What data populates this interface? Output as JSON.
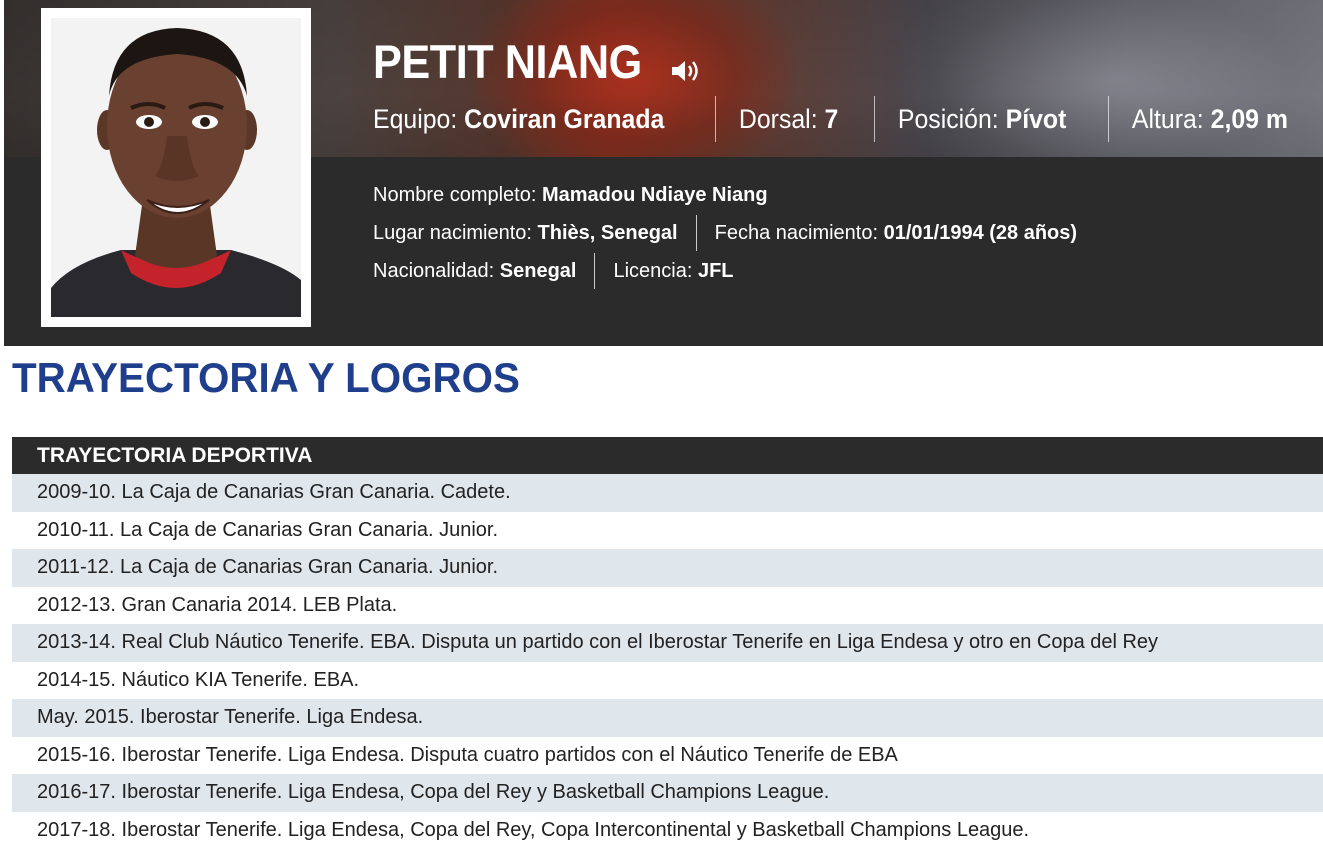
{
  "player": {
    "name": "PETIT NIANG",
    "team_label": "Equipo:",
    "team": "Coviran Granada",
    "number_label": "Dorsal:",
    "number": "7",
    "position_label": "Posición:",
    "position": "Pívot",
    "height_label": "Altura:",
    "height": "2,09 m",
    "full_name_label": "Nombre completo:",
    "full_name": "Mamadou Ndiaye Niang",
    "birthplace_label": "Lugar nacimiento:",
    "birthplace": "Thiès, Senegal",
    "birthdate_label": "Fecha nacimiento:",
    "birthdate": "01/01/1994 (28 años)",
    "nationality_label": "Nacionalidad:",
    "nationality": "Senegal",
    "license_label": "Licencia:",
    "license": "JFL"
  },
  "section": {
    "title": "TRAYECTORIA Y LOGROS"
  },
  "career": {
    "header": "TRAYECTORIA DEPORTIVA",
    "items": [
      "2009-10. La Caja de Canarias Gran Canaria. Cadete.",
      "2010-11. La Caja de Canarias Gran Canaria. Junior.",
      "2011-12. La Caja de Canarias Gran Canaria. Junior.",
      "2012-13. Gran Canaria 2014. LEB Plata.",
      "2013-14. Real Club Náutico Tenerife. EBA. Disputa un partido con el Iberostar Tenerife en Liga Endesa y otro en Copa del Rey",
      "2014-15. Náutico KIA Tenerife. EBA.",
      "May. 2015. Iberostar Tenerife. Liga Endesa.",
      "2015-16. Iberostar Tenerife. Liga Endesa. Disputa cuatro partidos con el Náutico Tenerife de EBA",
      "2016-17. Iberostar Tenerife. Liga Endesa, Copa del Rey y Basketball Champions League.",
      "2017-18. Iberostar Tenerife. Liga Endesa, Copa del Rey, Copa Intercontinental y Basketball Champions League."
    ]
  },
  "icons": {
    "audio": "speaker-icon"
  },
  "colors": {
    "title_blue": "#1f3e8c",
    "dark_band": "#2b2b2b",
    "row_stripe": "#dfe6ec"
  }
}
